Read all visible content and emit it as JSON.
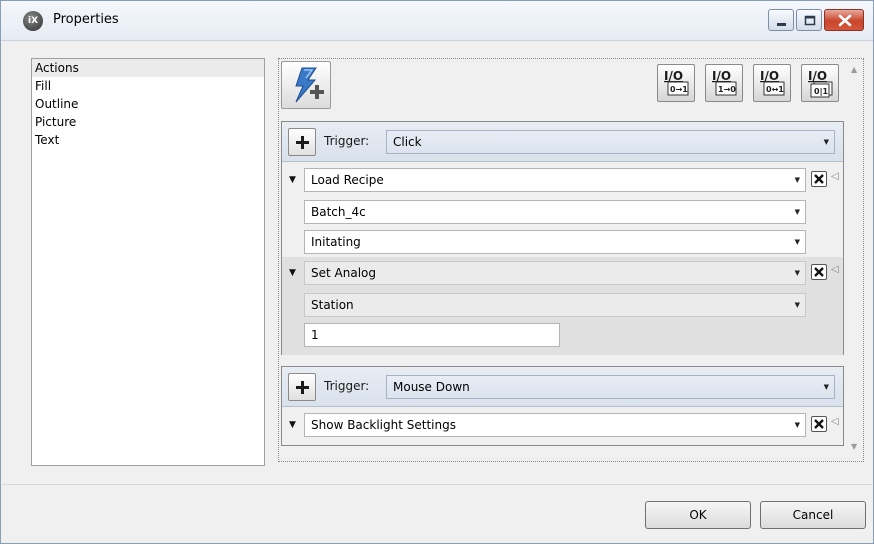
{
  "window": {
    "title": "Properties",
    "icon_text": "iX",
    "icon": "ix-app-icon"
  },
  "sidebar": {
    "items": [
      {
        "label": "Actions",
        "selected": true
      },
      {
        "label": "Fill",
        "selected": false
      },
      {
        "label": "Outline",
        "selected": false
      },
      {
        "label": "Picture",
        "selected": false
      },
      {
        "label": "Text",
        "selected": false
      }
    ]
  },
  "toolbar": {
    "add_action_icon": "lightning-plus-icon",
    "io_buttons": [
      {
        "icon": "io-zero-to-one-icon",
        "caption": "0→1"
      },
      {
        "icon": "io-one-to-zero-icon",
        "caption": "1→0"
      },
      {
        "icon": "io-toggle-icon",
        "caption": "0↔1"
      },
      {
        "icon": "io-set-icon",
        "caption": "0|1"
      }
    ]
  },
  "triggers": [
    {
      "label": "Trigger:",
      "value": "Click",
      "actions": [
        {
          "name": "Load Recipe",
          "params": [
            "Batch_4c",
            "Initating"
          ]
        },
        {
          "name": "Set Analog",
          "params": [
            "Station"
          ],
          "value": "1"
        }
      ]
    },
    {
      "label": "Trigger:",
      "value": "Mouse Down",
      "actions": [
        {
          "name": "Show Backlight Settings",
          "params": []
        }
      ]
    }
  ],
  "buttons": {
    "ok": "OK",
    "cancel": "Cancel"
  },
  "colors": {
    "close_button": "#c9462c",
    "trigger_header": "#dbe3ee",
    "selected_item": "#ebebeb"
  }
}
